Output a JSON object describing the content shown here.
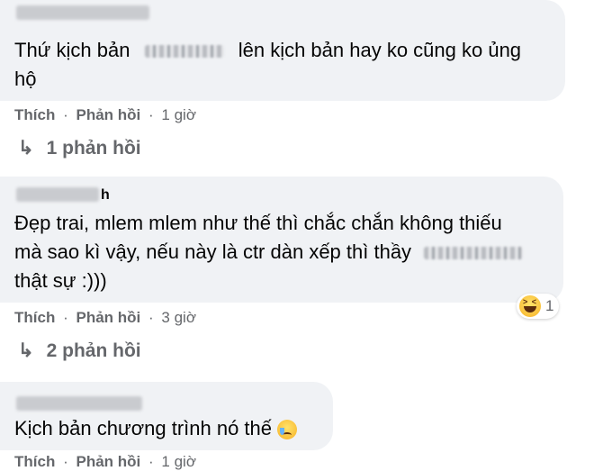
{
  "comments": [
    {
      "text_before": "Thứ kịch bản",
      "text_after": "lên kịch bản hay ko cũng ko ủng",
      "text_line2": "hộ",
      "actions": {
        "like": "Thích",
        "reply": "Phản hồi",
        "time": "1 giờ"
      },
      "replies_label": "1 phản hồi"
    },
    {
      "name_tail": "h",
      "line1": "Đẹp trai, mlem mlem như thế thì chắc chắn không thiếu",
      "line2_before": "mà sao kì vậy, nếu này là ctr dàn xếp thì thầy",
      "line3": "thật sự :)))",
      "reaction_count": "1",
      "reaction_icon": "haha-reaction-icon",
      "actions": {
        "like": "Thích",
        "reply": "Phản hồi",
        "time": "3 giờ"
      },
      "replies_label": "2 phản hồi"
    },
    {
      "text": "Kịch bản chương trình nó thế",
      "emoji": "crying-face-icon",
      "actions": {
        "like": "Thích",
        "reply": "Phản hồi",
        "time": "1 giờ"
      }
    }
  ],
  "icons": {
    "reply_arrow": "↳"
  },
  "colors": {
    "bubble": "#f0f2f5",
    "muted": "#65676b",
    "text": "#050505"
  }
}
